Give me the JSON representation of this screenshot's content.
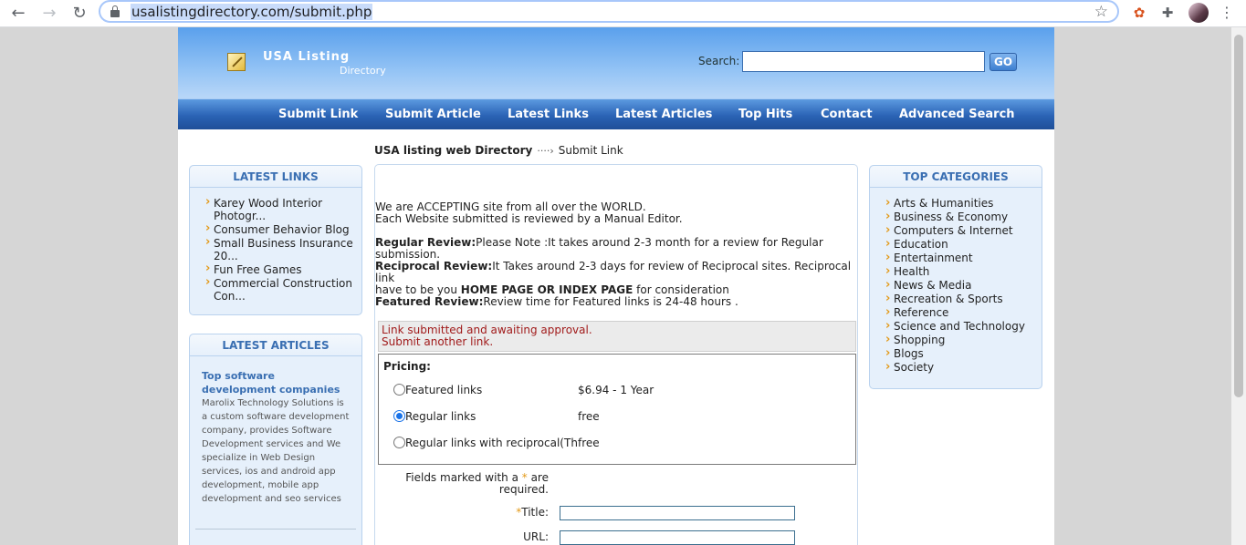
{
  "browser": {
    "url": "usalistingdirectory.com/submit.php"
  },
  "site": {
    "logo_title": "USA Listing",
    "logo_sub": "Directory",
    "search_label": "Search:",
    "search_value": "",
    "go_label": "GO",
    "nav": [
      "Submit Link",
      "Submit Article",
      "Latest Links",
      "Latest Articles",
      "Top Hits",
      "Contact",
      "Advanced Search"
    ]
  },
  "breadcrumb": {
    "home": "USA listing web Directory",
    "separator": "····›",
    "current": "Submit Link"
  },
  "latest_links": {
    "title": "LATEST LINKS",
    "items": [
      "Karey Wood Interior Photogr...",
      "Consumer Behavior Blog",
      "Small Business Insurance 20...",
      "Fun Free Games",
      "Commercial Construction Con..."
    ]
  },
  "latest_articles": {
    "title": "LATEST ARTICLES",
    "article_title": "Top software development companies",
    "article_text": "Marolix Technology Solutions is a custom software development company, provides Software Development services and We specialize in Web Design services, ios and android app development, mobile app development and seo services"
  },
  "top_categories": {
    "title": "TOP CATEGORIES",
    "items": [
      "Arts & Humanities",
      "Business & Economy",
      "Computers & Internet",
      "Education",
      "Entertainment",
      "Health",
      "News & Media",
      "Recreation & Sports",
      "Reference",
      "Science and Technology",
      "Shopping",
      "Blogs",
      "Society"
    ]
  },
  "main": {
    "intro_line1": "We are ACCEPTING site from all over the WORLD.",
    "intro_line2": "Each Website submitted is reviewed by a Manual Editor.",
    "regular_label": "Regular Review:",
    "regular_text": "Please Note :It takes around 2-3 month for a review for Regular submission.",
    "reciprocal_label": "Reciprocal Review:",
    "reciprocal_text": "It Takes around 2-3 days for review of Reciprocal sites. Reciprocal link",
    "reciprocal_text2a": "have to be you ",
    "reciprocal_text2b": "HOME PAGE OR INDEX PAGE",
    "reciprocal_text2c": " for consideration",
    "featured_label": "Featured Review:",
    "featured_text": "Review time for Featured links is 24-48 hours .",
    "alert_line1": "Link submitted and awaiting approval.",
    "alert_line2": "Submit another link.",
    "pricing_title": "Pricing:",
    "options": [
      {
        "label": "Featured links",
        "price": "$6.94 - 1 Year"
      },
      {
        "label": "Regular links",
        "price": "free"
      },
      {
        "label": "Regular links with reciprocal(Th",
        "price": "free"
      }
    ],
    "selected_option": "Regular links",
    "req_note_a": "Fields marked with a ",
    "req_note_star": "*",
    "req_note_b": " are required.",
    "title_label": "Title:",
    "url_label": "URL:"
  },
  "colors": {
    "header_top": "#5aa0ec",
    "nav_bar": "#2a63b5",
    "box_bg": "#e6f0fb",
    "box_title": "#3a6fb2",
    "bullet": "#e39a1a",
    "alert_text": "#a11b1b"
  }
}
